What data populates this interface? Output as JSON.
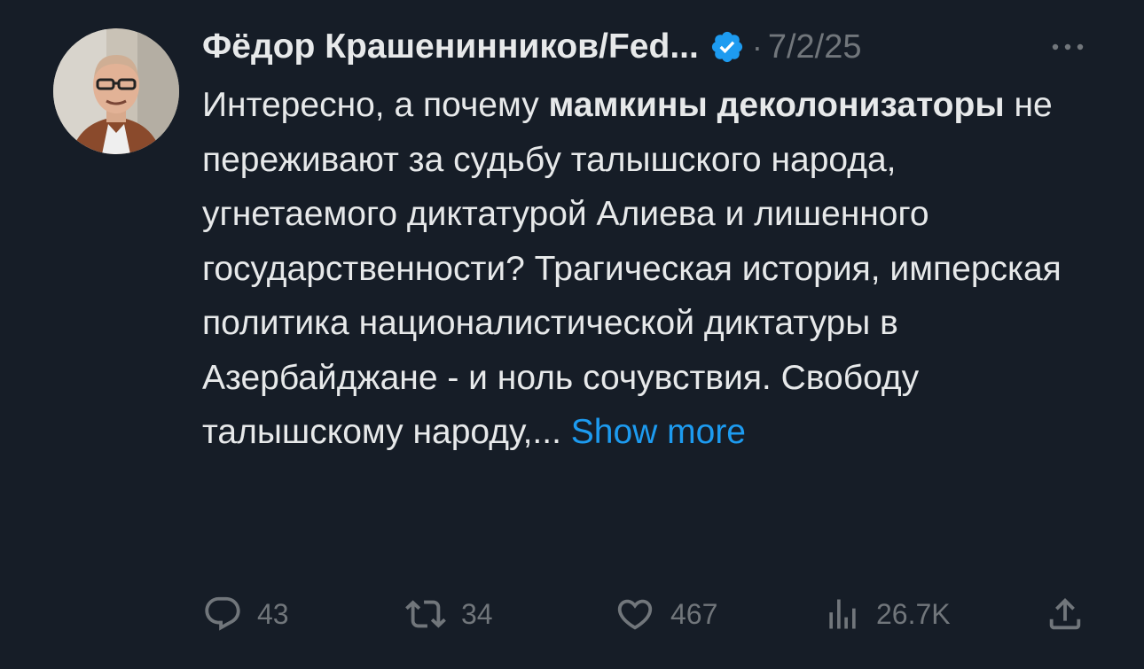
{
  "tweet": {
    "author_name": "Фёдор Крашенинников/Fed...",
    "separator": "·",
    "date": "7/2/25",
    "text_part1": "Интересно, а почему ",
    "text_bold1": "мамкины деколонизаторы",
    "text_part2": " не переживают за судьбу талышского народа, угнетаемого диктатурой Алиева и лишенного государственности? Трагическая история, имперская политика националистической диктатуры в Азербайджане - и ноль сочувствия. Свободу талышскому народу,... ",
    "show_more": "Show more",
    "colors": {
      "background": "#161d27",
      "text": "#e7e9ea",
      "muted": "#71767b",
      "accent": "#1d9bf0"
    },
    "icons": [
      "verified-badge-icon",
      "more-options-icon",
      "reply-icon",
      "retweet-icon",
      "like-icon",
      "views-icon",
      "share-icon"
    ]
  },
  "actions": {
    "replies": "43",
    "retweets": "34",
    "likes": "467",
    "views": "26.7K"
  }
}
